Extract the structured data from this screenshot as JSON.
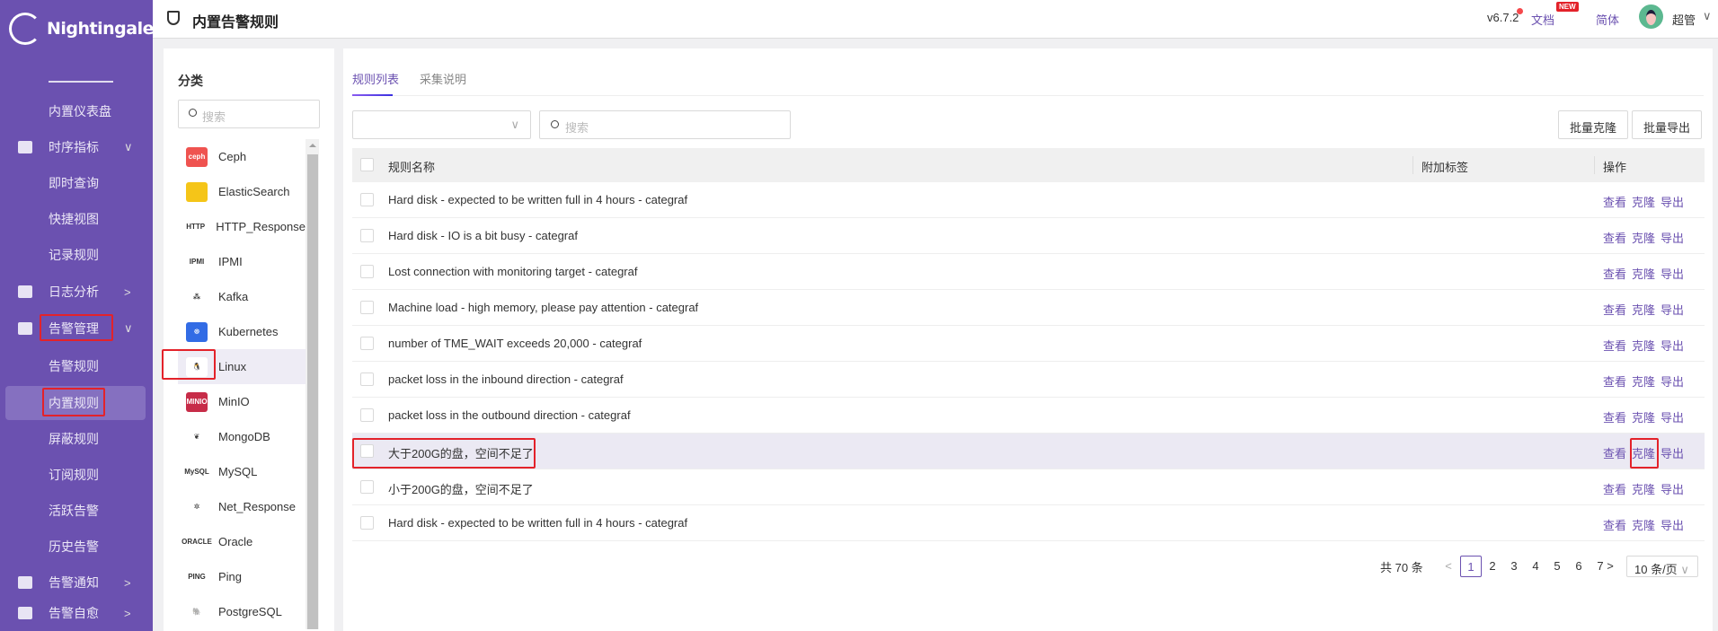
{
  "app": {
    "name": "Nightingale"
  },
  "sidebar": {
    "items": [
      {
        "label": "内置仪表盘",
        "icon": "",
        "chevron": ""
      },
      {
        "label": "时序指标",
        "icon": "chart-line-icon",
        "chevron": "∨"
      },
      {
        "label": "即时查询",
        "icon": "",
        "chevron": ""
      },
      {
        "label": "快捷视图",
        "icon": "",
        "chevron": ""
      },
      {
        "label": "记录规则",
        "icon": "",
        "chevron": ""
      },
      {
        "label": "日志分析",
        "icon": "log-file-icon",
        "chevron": ">"
      },
      {
        "label": "告警管理",
        "icon": "alarm-icon",
        "chevron": "∨"
      },
      {
        "label": "告警规则",
        "icon": "",
        "chevron": ""
      },
      {
        "label": "内置规则",
        "icon": "",
        "chevron": "",
        "active": true
      },
      {
        "label": "屏蔽规则",
        "icon": "",
        "chevron": ""
      },
      {
        "label": "订阅规则",
        "icon": "",
        "chevron": ""
      },
      {
        "label": "活跃告警",
        "icon": "",
        "chevron": ""
      },
      {
        "label": "历史告警",
        "icon": "",
        "chevron": ""
      },
      {
        "label": "告警通知",
        "icon": "megaphone-icon",
        "chevron": ">"
      },
      {
        "label": "告警自愈",
        "icon": "terminal-icon",
        "chevron": ">"
      }
    ]
  },
  "header": {
    "title": "内置告警规则",
    "version": "v6.7.2",
    "docs": "文档",
    "new_badge": "NEW",
    "language": "简体",
    "user": "超管"
  },
  "category": {
    "title": "分类",
    "search_placeholder": "搜索",
    "items": [
      {
        "label": "Ceph",
        "icon_text": "ceph",
        "color": "#ef5350"
      },
      {
        "label": "ElasticSearch",
        "icon_text": "",
        "color": "#f5c518"
      },
      {
        "label": "HTTP_Response",
        "icon_text": "HTTP",
        "color": "#ffffff"
      },
      {
        "label": "IPMI",
        "icon_text": "IPMI",
        "color": "#ffffff"
      },
      {
        "label": "Kafka",
        "icon_text": "⁂",
        "color": "#ffffff"
      },
      {
        "label": "Kubernetes",
        "icon_text": "☸",
        "color": "#326ce5"
      },
      {
        "label": "Linux",
        "icon_text": "🐧",
        "color": "#ffffff",
        "selected": true
      },
      {
        "label": "MinIO",
        "icon_text": "MINIO",
        "color": "#c72c48"
      },
      {
        "label": "MongoDB",
        "icon_text": "❦",
        "color": "#ffffff"
      },
      {
        "label": "MySQL",
        "icon_text": "MySQL",
        "color": "#ffffff"
      },
      {
        "label": "Net_Response",
        "icon_text": "✲",
        "color": "#ffffff"
      },
      {
        "label": "Oracle",
        "icon_text": "ORACLE",
        "color": "#ffffff"
      },
      {
        "label": "Ping",
        "icon_text": "PING",
        "color": "#ffffff"
      },
      {
        "label": "PostgreSQL",
        "icon_text": "🐘",
        "color": "#ffffff"
      }
    ]
  },
  "main": {
    "tabs": [
      "规则列表",
      "采集说明"
    ],
    "search_placeholder": "搜索",
    "batch_clone": "批量克隆",
    "batch_export": "批量导出",
    "columns": {
      "name": "规则名称",
      "tags": "附加标签",
      "ops": "操作"
    },
    "ops": {
      "view": "查看",
      "clone": "克隆",
      "export": "导出"
    },
    "rows": [
      {
        "name": "Hard disk - expected to be written full in 4 hours - categraf"
      },
      {
        "name": "Hard disk - IO is a bit busy - categraf"
      },
      {
        "name": "Lost connection with monitoring target - categraf"
      },
      {
        "name": "Machine load - high memory, please pay attention - categraf"
      },
      {
        "name": "number of TME_WAIT exceeds 20,000 - categraf"
      },
      {
        "name": "packet loss in the inbound direction - categraf"
      },
      {
        "name": "packet loss in the outbound direction - categraf"
      },
      {
        "name": "大于200G的盘，空间不足了",
        "highlighted": true
      },
      {
        "name": "小于200G的盘，空间不足了"
      },
      {
        "name": "Hard disk - expected to be written full in 4 hours - categraf"
      }
    ],
    "pagination": {
      "total": "共 70 条",
      "pages": [
        "1",
        "2",
        "3",
        "4",
        "5",
        "6",
        "7"
      ],
      "current": "1",
      "page_size": "10 条/页"
    }
  }
}
